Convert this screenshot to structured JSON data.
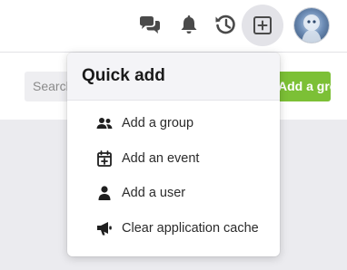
{
  "topbar": {
    "icons": {
      "chat": "chat-bubbles-icon",
      "notifications": "bell-icon",
      "history": "history-icon",
      "quick_add": "plus-square-icon"
    }
  },
  "page": {
    "search_placeholder": "Search",
    "add_group_label": "Add a group"
  },
  "quick_add": {
    "title": "Quick add",
    "items": [
      {
        "label": "Add a group",
        "icon": "users-icon"
      },
      {
        "label": "Add an event",
        "icon": "calendar-plus-icon"
      },
      {
        "label": "Add a user",
        "icon": "user-icon"
      },
      {
        "label": "Clear application cache",
        "icon": "megaphone-icon"
      }
    ]
  },
  "colors": {
    "accent_green": "#7cc036",
    "active_button_bg": "#e3e3e8"
  }
}
